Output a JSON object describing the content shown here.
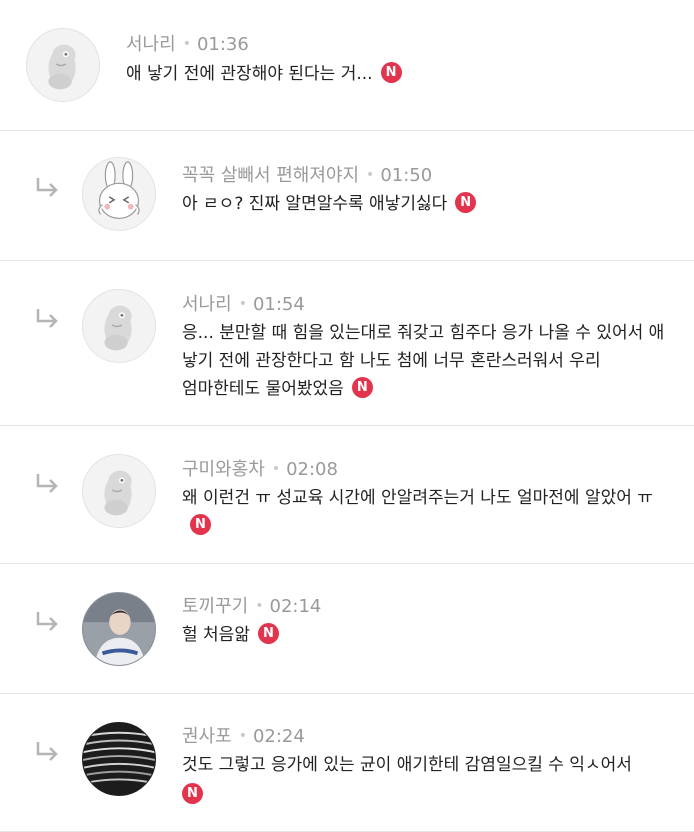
{
  "comments": [
    {
      "author": "서나리",
      "time": "01:36",
      "text": "애 낳기 전에 관장해야 된다는 거...",
      "badge": "N",
      "reply": false,
      "avatar": "kakao-character"
    },
    {
      "author": "꼭꼭 살빼서 편해져야지",
      "time": "01:50",
      "text": "아 ㄹㅇ? 진짜 알면알수록 애낳기싫다",
      "badge": "N",
      "reply": true,
      "avatar": "rabbit-character"
    },
    {
      "author": "서나리",
      "time": "01:54",
      "text": "응... 분만할 때 힘을 있는대로 줘갖고 힘주다 응가 나올 수 있어서 애 낳기 전에 관장한다고 함 나도 첨에 너무 혼란스러워서 우리 엄마한테도 물어봤었음",
      "badge": "N",
      "reply": true,
      "avatar": "kakao-character"
    },
    {
      "author": "구미와홍차",
      "time": "02:08",
      "text": "왜 이런건 ㅠ 성교육 시간에 안알려주는거 나도 얼마전에 알았어 ㅠ",
      "badge": "N",
      "reply": true,
      "avatar": "kakao-character"
    },
    {
      "author": "토끼꾸기",
      "time": "02:14",
      "text": "헐 처음앎",
      "badge": "N",
      "reply": true,
      "avatar": "person-photo"
    },
    {
      "author": "권사포",
      "time": "02:24",
      "text": "것도 그렇고 응가에 있는 균이 애기한테 감염일으킬 수 익ㅅ어서",
      "badge": "N",
      "reply": true,
      "avatar": "abstract-photo"
    }
  ],
  "colors": {
    "badge": "#e2344c",
    "meta": "#9a9a9a",
    "divider": "#e4e4e4",
    "reply_arrow": "#b5b5b5"
  }
}
